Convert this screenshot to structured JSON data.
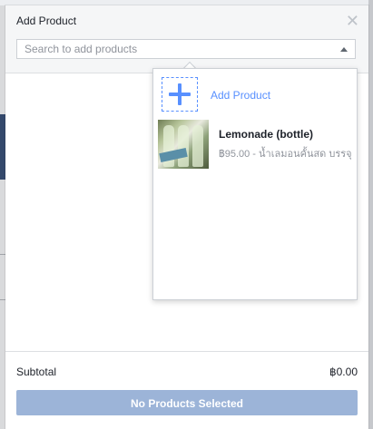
{
  "modal": {
    "title": "Add Product",
    "close_icon": "close-icon",
    "search": {
      "placeholder": "Search to add products",
      "value": ""
    }
  },
  "dropdown": {
    "add_label": "Add Product",
    "add_icon": "plus-icon",
    "products": [
      {
        "name": "Lemonade (bottle)",
        "meta": "฿95.00 - น้ำเลมอนคั้นสด บรรจุ"
      }
    ]
  },
  "footer": {
    "subtotal_label": "Subtotal",
    "subtotal_value": "฿0.00",
    "submit_label": "No Products Selected"
  },
  "colors": {
    "accent": "#5890ff",
    "disabled_button": "#9cb4d8",
    "header_bg": "#f5f6f7"
  }
}
